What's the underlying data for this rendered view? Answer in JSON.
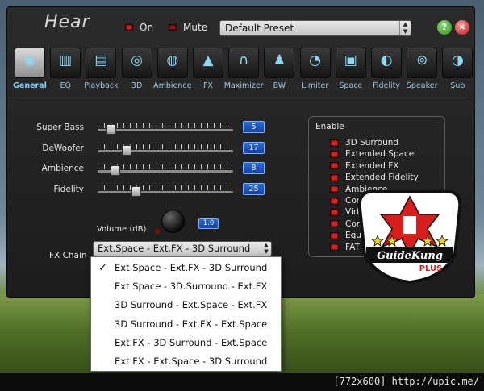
{
  "app": {
    "title": "Hear",
    "on_label": "On",
    "mute_label": "Mute",
    "preset": "Default Preset",
    "help_glyph": "?",
    "close_glyph": "x"
  },
  "tabs": [
    {
      "label": "General",
      "icon": "speaker-icon",
      "glyph": "◉",
      "active": true
    },
    {
      "label": "EQ",
      "icon": "equalizer-icon",
      "glyph": "▥",
      "active": false
    },
    {
      "label": "Playback",
      "icon": "spectrum-icon",
      "glyph": "▤",
      "active": false
    },
    {
      "label": "3D",
      "icon": "speakers-grid-icon",
      "glyph": "◎",
      "active": false
    },
    {
      "label": "Ambience",
      "icon": "ambience-speaker-icon",
      "glyph": "◍",
      "active": false
    },
    {
      "label": "FX",
      "icon": "fx-cone-icon",
      "glyph": "▲",
      "active": false
    },
    {
      "label": "Maximizer",
      "icon": "headphones-icon",
      "glyph": "∩",
      "active": false
    },
    {
      "label": "BW",
      "icon": "joystick-icon",
      "glyph": "♟",
      "active": false
    },
    {
      "label": "Limiter",
      "icon": "meter-icon",
      "glyph": "◔",
      "active": false
    },
    {
      "label": "Space",
      "icon": "space-cube-icon",
      "glyph": "▣",
      "active": false
    },
    {
      "label": "Fidelity",
      "icon": "fidelity-speaker-icon",
      "glyph": "◐",
      "active": false
    },
    {
      "label": "Speaker",
      "icon": "turntable-icon",
      "glyph": "⊚",
      "active": false
    },
    {
      "label": "Sub",
      "icon": "subwoofer-icon",
      "glyph": "◑",
      "active": false
    }
  ],
  "sliders": [
    {
      "label": "Super Bass",
      "value": "5",
      "pos": 0.07
    },
    {
      "label": "DeWoofer",
      "value": "17",
      "pos": 0.19
    },
    {
      "label": "Ambience",
      "value": "8",
      "pos": 0.1
    },
    {
      "label": "Fidelity",
      "value": "25",
      "pos": 0.27
    }
  ],
  "volume": {
    "label": "Volume (dB)",
    "value": "1.0"
  },
  "fx_chain": {
    "label": "FX Chain",
    "selected": "Ext.Space - Ext.FX - 3D Surround",
    "options": [
      "Ext.Space - Ext.FX - 3D Surround",
      "Ext.Space - 3D.Surround - Ext.FX",
      "3D Surround - Ext.Space - Ext.FX",
      "3D Surround - Ext.FX - Ext.Space",
      "Ext.FX - 3D Surround - Ext.Space",
      "Ext.FX - Ext.Space - 3D Surround"
    ]
  },
  "enable": {
    "title": "Enable",
    "items": [
      "3D Surround",
      "Extended Space",
      "Extended FX",
      "Extended Fidelity",
      "Ambience",
      "Cont",
      "Virtu",
      "Comp",
      "Equal",
      "FAT"
    ]
  },
  "logo": {
    "text": "GuideKung",
    "sub": "PLUS"
  },
  "footer": {
    "text": "[772x600] http://upic.me/"
  },
  "colors": {
    "accent_blue": "#2a6bd8",
    "led_red": "#e02020",
    "tab_label": "#9ec6e0"
  }
}
